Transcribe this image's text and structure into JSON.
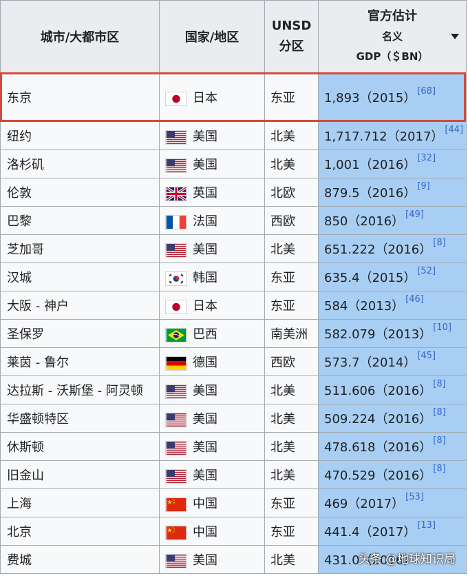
{
  "header": {
    "col_city": "城市/大都市区",
    "col_country": "国家/地区",
    "col_region_line1": "UNSD",
    "col_region_line2": "分区",
    "col_gdp_line1": "官方估计",
    "col_gdp_line2": "名义",
    "col_gdp_line3": "GDP（＄BN）"
  },
  "rows": [
    {
      "city": "东京",
      "country": "日本",
      "flag": "japan-flag-icon",
      "region": "东亚",
      "gdp": "1,893（2015）",
      "ref": "[68]"
    },
    {
      "city": "纽约",
      "country": "美国",
      "flag": "usa-flag-icon",
      "region": "北美",
      "gdp": "1,717.712（2017）",
      "ref": "[44]"
    },
    {
      "city": "洛杉矶",
      "country": "美国",
      "flag": "usa-flag-icon",
      "region": "北美",
      "gdp": "1,001（2016）",
      "ref": "[32]"
    },
    {
      "city": "伦敦",
      "country": "英国",
      "flag": "uk-flag-icon",
      "region": "北欧",
      "gdp": "879.5（2016）",
      "ref": "[9]"
    },
    {
      "city": "巴黎",
      "country": "法国",
      "flag": "france-flag-icon",
      "region": "西欧",
      "gdp": "850（2016）",
      "ref": "[49]"
    },
    {
      "city": "芝加哥",
      "country": "美国",
      "flag": "usa-flag-icon",
      "region": "北美",
      "gdp": "651.222（2016）",
      "ref": "[8]"
    },
    {
      "city": "汉城",
      "country": "韩国",
      "flag": "korea-flag-icon",
      "region": "东亚",
      "gdp": "635.4（2015）",
      "ref": "[52]"
    },
    {
      "city": "大阪 - 神户",
      "country": "日本",
      "flag": "japan-flag-icon",
      "region": "东亚",
      "gdp": "584（2013）",
      "ref": "[46]"
    },
    {
      "city": "圣保罗",
      "country": "巴西",
      "flag": "brazil-flag-icon",
      "region": "南美洲",
      "gdp": "582.079（2013）",
      "ref": "[10]"
    },
    {
      "city": "莱茵 - 鲁尔",
      "country": "德国",
      "flag": "germany-flag-icon",
      "region": "西欧",
      "gdp": "573.7（2014）",
      "ref": "[45]"
    },
    {
      "city": "达拉斯 - 沃斯堡 - 阿灵顿",
      "country": "美国",
      "flag": "usa-flag-icon",
      "region": "北美",
      "gdp": "511.606（2016）",
      "ref": "[8]"
    },
    {
      "city": "华盛顿特区",
      "country": "美国",
      "flag": "usa-flag-icon",
      "region": "北美",
      "gdp": "509.224（2016）",
      "ref": "[8]"
    },
    {
      "city": "休斯顿",
      "country": "美国",
      "flag": "usa-flag-icon",
      "region": "北美",
      "gdp": "478.618（2016）",
      "ref": "[8]"
    },
    {
      "city": "旧金山",
      "country": "美国",
      "flag": "usa-flag-icon",
      "region": "北美",
      "gdp": "470.529（2016）",
      "ref": "[8]"
    },
    {
      "city": "上海",
      "country": "中国",
      "flag": "china-flag-icon",
      "region": "东亚",
      "gdp": "469（2017）",
      "ref": "[53]"
    },
    {
      "city": "北京",
      "country": "中国",
      "flag": "china-flag-icon",
      "region": "东亚",
      "gdp": "441.4（2017）",
      "ref": "[13]"
    },
    {
      "city": "费城",
      "country": "美国",
      "flag": "usa-flag-icon",
      "region": "北美",
      "gdp": "431.0（2016）",
      "ref": ""
    }
  ],
  "watermark": "头条 @地球知识局"
}
